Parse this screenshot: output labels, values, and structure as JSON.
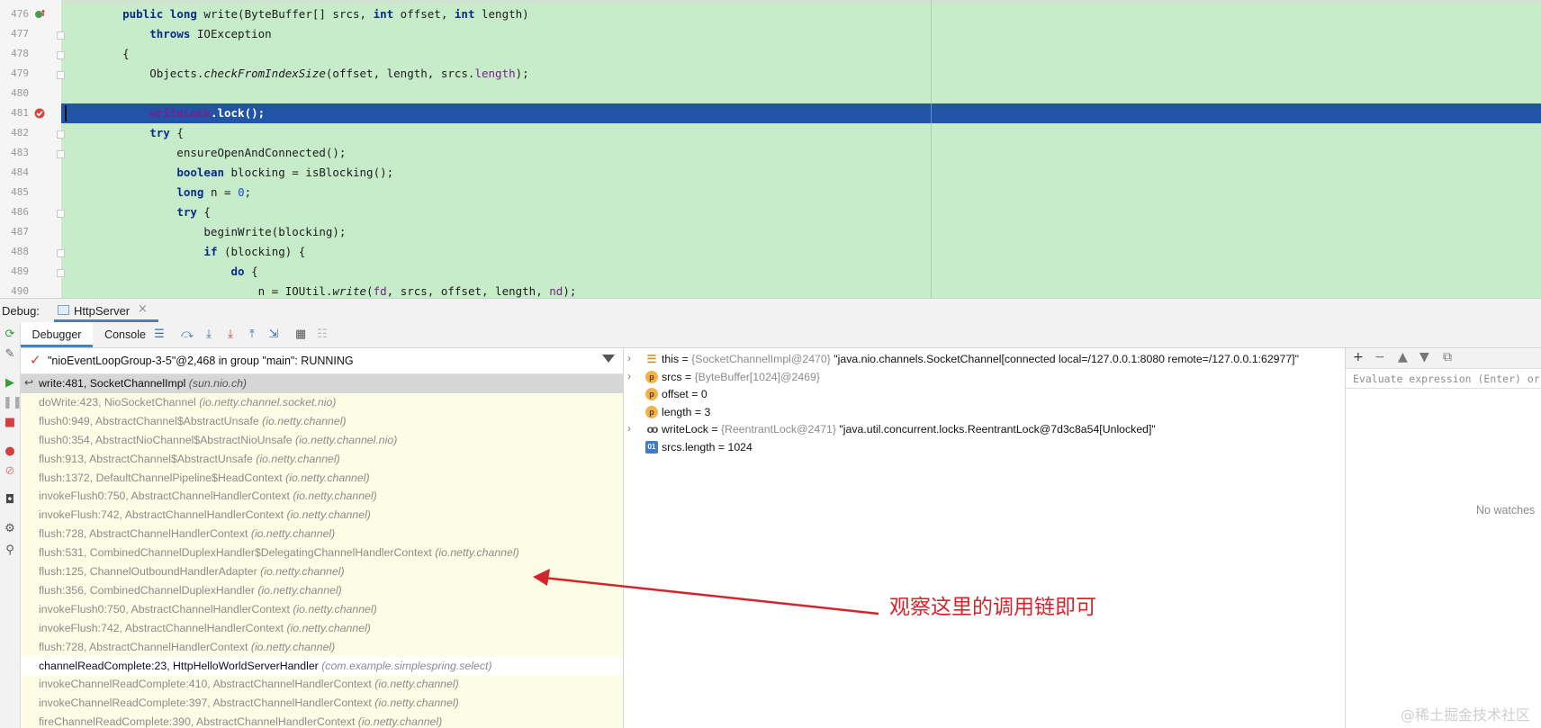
{
  "editor": {
    "lines": [
      {
        "num": "476",
        "tokens": [
          [
            "    ",
            ""
          ],
          [
            "public",
            "kw"
          ],
          [
            " ",
            ""
          ],
          [
            "long",
            "kw"
          ],
          [
            " write(ByteBuffer[] srcs, ",
            ""
          ],
          [
            "int",
            "kw"
          ],
          [
            " offset, ",
            ""
          ],
          [
            "int",
            "kw"
          ],
          [
            " length)",
            ""
          ]
        ],
        "icon": "override"
      },
      {
        "num": "477",
        "tokens": [
          [
            "        ",
            ""
          ],
          [
            "throws",
            "kw"
          ],
          [
            " IOException",
            ""
          ]
        ]
      },
      {
        "num": "478",
        "tokens": [
          [
            "    {",
            ""
          ]
        ]
      },
      {
        "num": "479",
        "tokens": [
          [
            "        Objects.",
            ""
          ],
          [
            "checkFromIndexSize",
            "it"
          ],
          [
            "(offset, length, srcs.",
            ""
          ],
          [
            "length",
            "fld"
          ],
          [
            ");",
            ""
          ]
        ]
      },
      {
        "num": "480",
        "tokens": [
          [
            "",
            ""
          ]
        ]
      },
      {
        "num": "481",
        "tokens": [
          [
            "        ",
            ""
          ],
          [
            "writeLock",
            "fld"
          ],
          [
            ".lock();",
            ""
          ]
        ],
        "selected": true,
        "icon": "breakpoint"
      },
      {
        "num": "482",
        "tokens": [
          [
            "        ",
            ""
          ],
          [
            "try",
            "kw"
          ],
          [
            " {",
            ""
          ]
        ]
      },
      {
        "num": "483",
        "tokens": [
          [
            "            ensureOpenAndConnected();",
            ""
          ]
        ]
      },
      {
        "num": "484",
        "tokens": [
          [
            "            ",
            ""
          ],
          [
            "boolean",
            "kw"
          ],
          [
            " blocking = isBlocking();",
            ""
          ]
        ]
      },
      {
        "num": "485",
        "tokens": [
          [
            "            ",
            ""
          ],
          [
            "long",
            "kw"
          ],
          [
            " n = ",
            ""
          ],
          [
            "0",
            "num"
          ],
          [
            ";",
            ""
          ]
        ]
      },
      {
        "num": "486",
        "tokens": [
          [
            "            ",
            ""
          ],
          [
            "try",
            "kw"
          ],
          [
            " {",
            ""
          ]
        ]
      },
      {
        "num": "487",
        "tokens": [
          [
            "                beginWrite(blocking);",
            ""
          ]
        ]
      },
      {
        "num": "488",
        "tokens": [
          [
            "                ",
            ""
          ],
          [
            "if",
            "kw"
          ],
          [
            " (blocking) {",
            ""
          ]
        ]
      },
      {
        "num": "489",
        "tokens": [
          [
            "                    ",
            ""
          ],
          [
            "do",
            "kw"
          ],
          [
            " {",
            ""
          ]
        ]
      },
      {
        "num": "490",
        "tokens": [
          [
            "                        n = IOUtil.",
            ""
          ],
          [
            "write",
            "it"
          ],
          [
            "(",
            ""
          ],
          [
            "fd",
            "fld"
          ],
          [
            ", srcs, offset, length, ",
            ""
          ],
          [
            "nd",
            "fld"
          ],
          [
            ");",
            ""
          ]
        ]
      }
    ]
  },
  "debug_header": {
    "label": "Debug:",
    "run_tab": "HttpServer",
    "close": "×"
  },
  "toolbar": {
    "tabs": [
      "Debugger",
      "Console"
    ]
  },
  "thread": {
    "text": "\"nioEventLoopGroup-3-5\"@2,468 in group \"main\": RUNNING"
  },
  "frames": [
    {
      "method": "write:481, SocketChannelImpl",
      "pkg": "(sun.nio.ch)",
      "state": "active"
    },
    {
      "method": "doWrite:423, NioSocketChannel",
      "pkg": "(io.netty.channel.socket.nio)",
      "state": "lib"
    },
    {
      "method": "flush0:949, AbstractChannel$AbstractUnsafe",
      "pkg": "(io.netty.channel)",
      "state": "lib"
    },
    {
      "method": "flush0:354, AbstractNioChannel$AbstractNioUnsafe",
      "pkg": "(io.netty.channel.nio)",
      "state": "lib"
    },
    {
      "method": "flush:913, AbstractChannel$AbstractUnsafe",
      "pkg": "(io.netty.channel)",
      "state": "lib"
    },
    {
      "method": "flush:1372, DefaultChannelPipeline$HeadContext",
      "pkg": "(io.netty.channel)",
      "state": "lib"
    },
    {
      "method": "invokeFlush0:750, AbstractChannelHandlerContext",
      "pkg": "(io.netty.channel)",
      "state": "lib"
    },
    {
      "method": "invokeFlush:742, AbstractChannelHandlerContext",
      "pkg": "(io.netty.channel)",
      "state": "lib"
    },
    {
      "method": "flush:728, AbstractChannelHandlerContext",
      "pkg": "(io.netty.channel)",
      "state": "lib"
    },
    {
      "method": "flush:531, CombinedChannelDuplexHandler$DelegatingChannelHandlerContext",
      "pkg": "(io.netty.channel)",
      "state": "lib"
    },
    {
      "method": "flush:125, ChannelOutboundHandlerAdapter",
      "pkg": "(io.netty.channel)",
      "state": "lib"
    },
    {
      "method": "flush:356, CombinedChannelDuplexHandler",
      "pkg": "(io.netty.channel)",
      "state": "lib"
    },
    {
      "method": "invokeFlush0:750, AbstractChannelHandlerContext",
      "pkg": "(io.netty.channel)",
      "state": "lib"
    },
    {
      "method": "invokeFlush:742, AbstractChannelHandlerContext",
      "pkg": "(io.netty.channel)",
      "state": "lib"
    },
    {
      "method": "flush:728, AbstractChannelHandlerContext",
      "pkg": "(io.netty.channel)",
      "state": "lib"
    },
    {
      "method": "channelReadComplete:23, HttpHelloWorldServerHandler",
      "pkg": "(com.example.simplespring.select)",
      "state": "user"
    },
    {
      "method": "invokeChannelReadComplete:410, AbstractChannelHandlerContext",
      "pkg": "(io.netty.channel)",
      "state": "lib"
    },
    {
      "method": "invokeChannelReadComplete:397, AbstractChannelHandlerContext",
      "pkg": "(io.netty.channel)",
      "state": "lib"
    },
    {
      "method": "fireChannelReadComplete:390, AbstractChannelHandlerContext",
      "pkg": "(io.netty.channel)",
      "state": "lib"
    }
  ],
  "variables": [
    {
      "expandable": true,
      "icon": "this",
      "name": "this",
      "ref": "{SocketChannelImpl@2470}",
      "value": "\"java.nio.channels.SocketChannel[connected local=/127.0.0.1:8080 remote=/127.0.0.1:62977]\""
    },
    {
      "expandable": true,
      "icon": "param",
      "name": "srcs",
      "ref": "{ByteBuffer[1024]@2469}",
      "value": ""
    },
    {
      "expandable": false,
      "icon": "param",
      "name": "offset",
      "ref": "",
      "value": "0"
    },
    {
      "expandable": false,
      "icon": "param",
      "name": "length",
      "ref": "",
      "value": "3"
    },
    {
      "expandable": true,
      "icon": "watch",
      "name": "writeLock",
      "ref": "{ReentrantLock@2471}",
      "value": "\"java.util.concurrent.locks.ReentrantLock@7d3c8a54[Unlocked]\""
    },
    {
      "expandable": false,
      "icon": "prim",
      "name": "srcs.length",
      "ref": "",
      "value": "1024"
    }
  ],
  "watches": {
    "eval_placeholder": "Evaluate expression (Enter) or add a watch (Ctrl+Shift+Enter)",
    "empty_text": "No watches"
  },
  "annotation": {
    "text": "观察这里的调用链即可",
    "color": "#d3262c"
  },
  "watermark": "@稀土掘金技术社区",
  "colors": {
    "editor_bg": "#c7ecc9",
    "selection": "#2154a6",
    "frame_bg": "#fdfde5",
    "tab_accent": "#4083c9"
  }
}
